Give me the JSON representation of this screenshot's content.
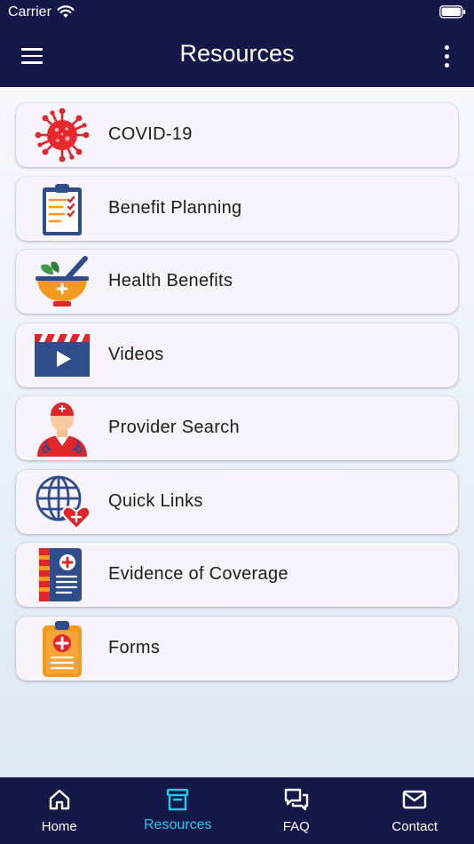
{
  "status_bar": {
    "carrier": "Carrier"
  },
  "header": {
    "title": "Resources"
  },
  "resources": [
    {
      "label": "COVID-19",
      "icon": "virus-icon"
    },
    {
      "label": "Benefit Planning",
      "icon": "clipboard-checklist-icon"
    },
    {
      "label": "Health Benefits",
      "icon": "mortar-pestle-icon"
    },
    {
      "label": "Videos",
      "icon": "clapperboard-icon"
    },
    {
      "label": "Provider Search",
      "icon": "doctor-icon"
    },
    {
      "label": "Quick Links",
      "icon": "globe-heart-icon"
    },
    {
      "label": "Evidence of Coverage",
      "icon": "medical-book-icon"
    },
    {
      "label": "Forms",
      "icon": "medical-form-icon"
    }
  ],
  "tabbar": {
    "tabs": [
      {
        "label": "Home",
        "icon": "home-icon"
      },
      {
        "label": "Resources",
        "icon": "archive-box-icon",
        "active": true
      },
      {
        "label": "FAQ",
        "icon": "chat-bubbles-icon"
      },
      {
        "label": "Contact",
        "icon": "envelope-icon"
      }
    ]
  },
  "colors": {
    "header_bg": "#16184a",
    "active_tab": "#29c8e9",
    "card_bg": "#f7f3fa"
  }
}
